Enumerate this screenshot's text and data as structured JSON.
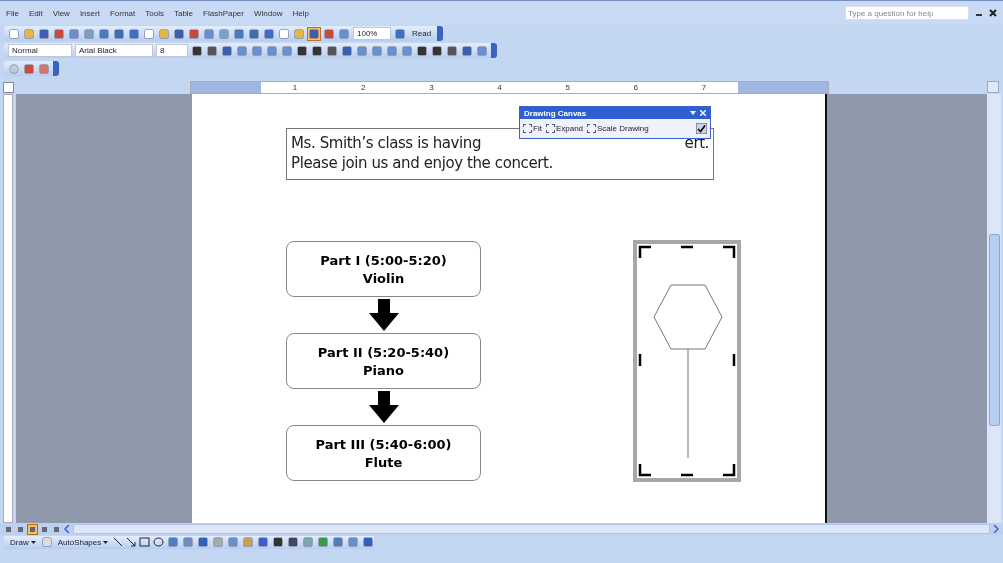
{
  "menu": [
    "File",
    "Edit",
    "View",
    "Insert",
    "Format",
    "Tools",
    "Table",
    "FlashPaper",
    "Window",
    "Help"
  ],
  "help_search": {
    "placeholder": "Type a question for help"
  },
  "standard_toolbar": {
    "buttons": [
      {
        "selected": false
      },
      {
        "selected": false
      },
      {
        "selected": false
      },
      {
        "selected": false
      },
      {
        "selected": false
      },
      {
        "selected": false
      },
      {
        "selected": false
      },
      {
        "selected": false
      },
      {
        "selected": false
      },
      {
        "selected": false
      },
      {
        "selected": false
      },
      {
        "selected": false
      },
      {
        "selected": false
      },
      {
        "selected": false
      },
      {
        "selected": false
      },
      {
        "selected": false
      },
      {
        "selected": false
      },
      {
        "selected": false
      },
      {
        "selected": false
      },
      {
        "selected": false
      },
      {
        "selected": true
      },
      {
        "selected": false
      },
      {
        "selected": false
      }
    ],
    "zoom": "100%",
    "read": "Read"
  },
  "formatting_toolbar": {
    "style": "Normal",
    "font": "Arial Black",
    "size": "8"
  },
  "ruler_labels": [
    "1",
    "2",
    "3",
    "4",
    "5",
    "6",
    "7"
  ],
  "document": {
    "text_box": [
      [
        "Ms. Smith’s class is having",
        "ert."
      ],
      [
        "Please join us and enjoy the concert."
      ]
    ],
    "flow_boxes": [
      {
        "title": "Part I (5:00-5:20)",
        "instrument": "Violin"
      },
      {
        "title": "Part II (5:20-5:40)",
        "instrument": "Piano"
      },
      {
        "title": "Part III (5:40-6:00)",
        "instrument": "Flute"
      }
    ]
  },
  "canvas_toolbar": {
    "title": "Drawing Canvas",
    "buttons": [
      "Fit",
      "Expand",
      "Scale Drawing"
    ]
  },
  "view_buttons": [
    {
      "selected": false
    },
    {
      "selected": false
    },
    {
      "selected": true
    },
    {
      "selected": false
    },
    {
      "selected": false
    }
  ],
  "draw_toolbar": {
    "draw": "Draw",
    "autoshapes": "AutoShapes"
  }
}
